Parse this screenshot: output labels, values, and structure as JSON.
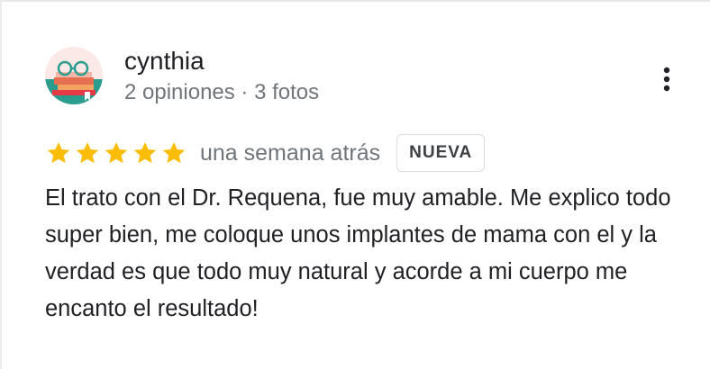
{
  "review": {
    "author": {
      "name": "cynthia",
      "meta": "2 opiniones · 3 fotos",
      "avatar_icon": "avatar-illustration"
    },
    "menu_icon": "more-vert-icon",
    "rating": {
      "stars": 5,
      "max": 5,
      "star_color": "#fbbc04"
    },
    "date": "una semana atrás",
    "badge": "NUEVA",
    "text": "El trato con el Dr. Requena, fue muy amable. Me explico todo super bien, me coloque unos implantes de mama con el y la verdad es que todo muy natural y acorde a mi cuerpo me encanto el resultado!"
  }
}
